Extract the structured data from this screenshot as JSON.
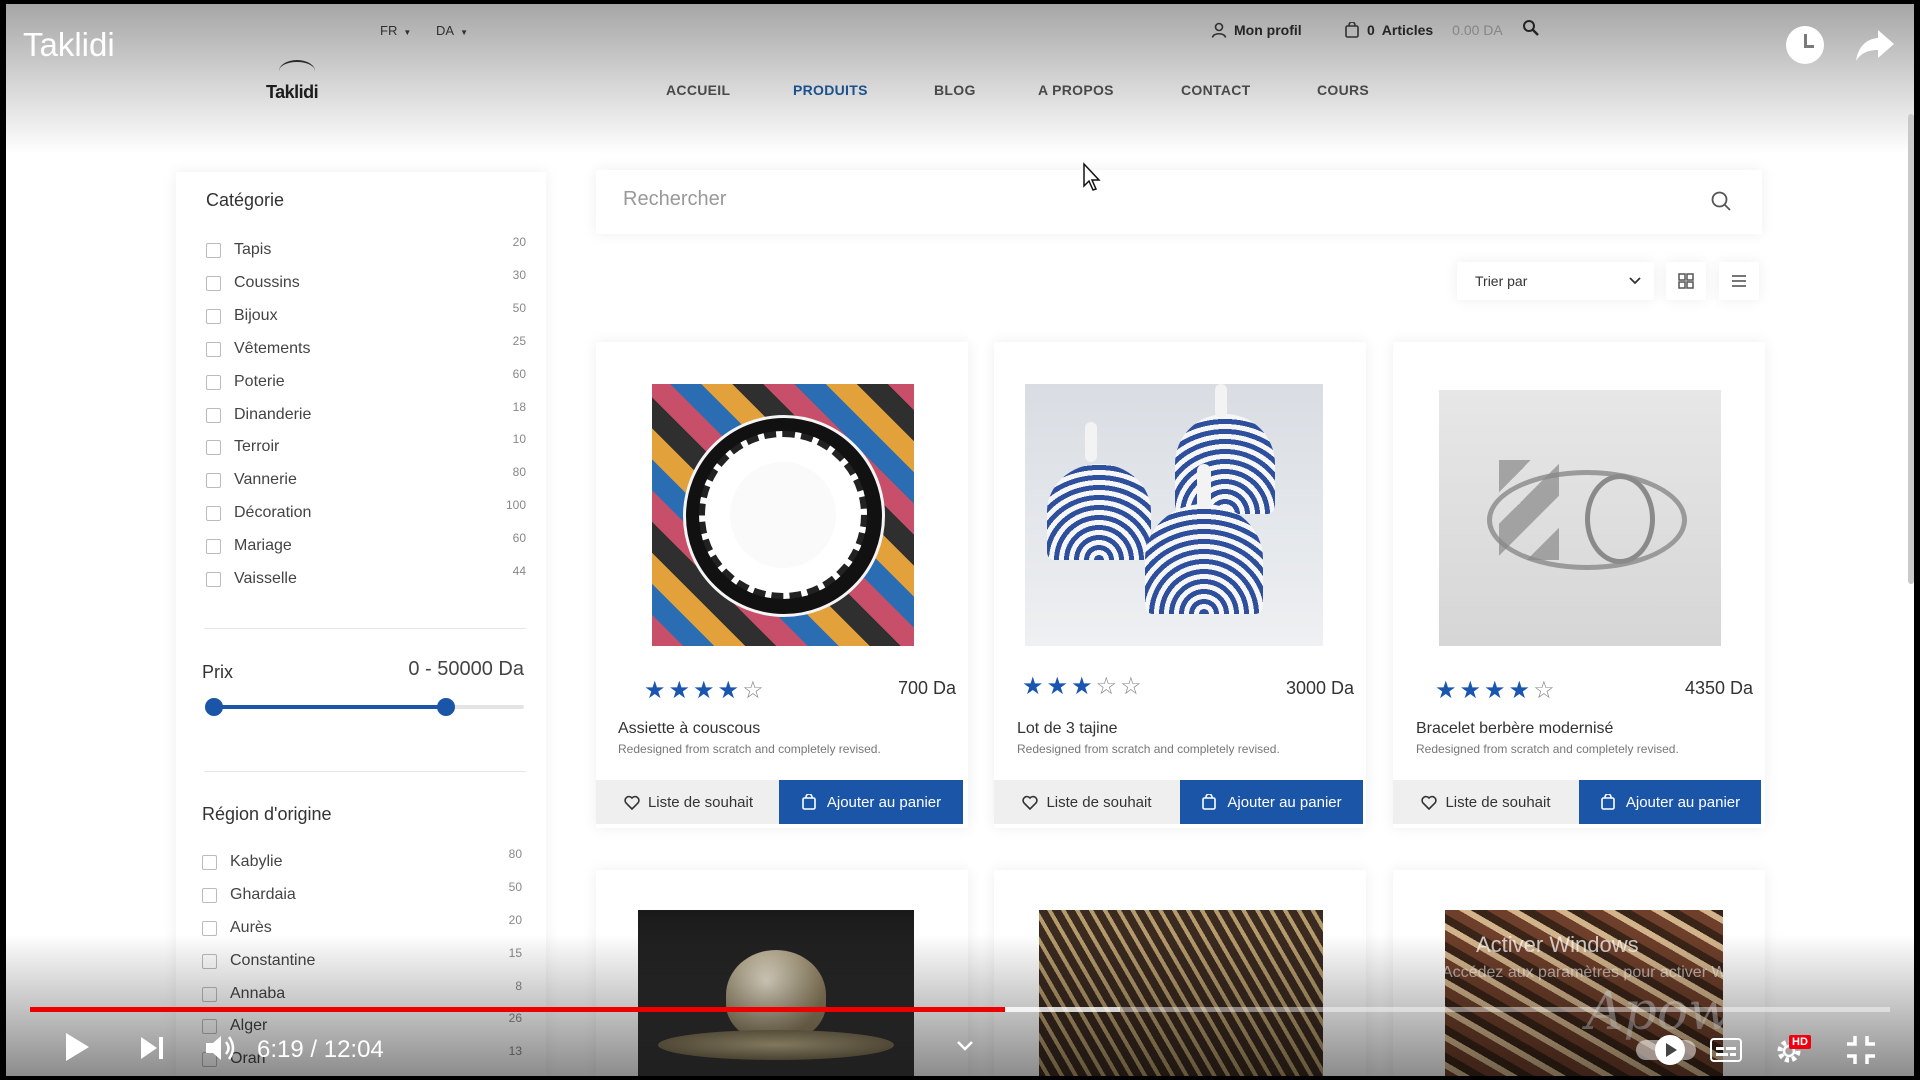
{
  "video": {
    "title": "Taklidi",
    "time": "6:19 / 12:04",
    "progress": 0.524,
    "hd": "HD"
  },
  "header": {
    "logo": "Taklidi",
    "lang": "FR",
    "currency": "DA",
    "profile": "Mon profil",
    "cart_count": "0",
    "cart_label": "Articles",
    "cart_total": "0.00 DA"
  },
  "nav": [
    {
      "label": "ACCUEIL"
    },
    {
      "label": "PRODUITS",
      "active": true
    },
    {
      "label": "BLOG"
    },
    {
      "label": "A PROPOS"
    },
    {
      "label": "CONTACT"
    },
    {
      "label": "COURS"
    }
  ],
  "sidebar": {
    "category_title": "Catégorie",
    "categories": [
      {
        "label": "Tapis",
        "count": "20"
      },
      {
        "label": "Coussins",
        "count": "30"
      },
      {
        "label": "Bijoux",
        "count": "50"
      },
      {
        "label": "Vêtements",
        "count": "25"
      },
      {
        "label": "Poterie",
        "count": "60"
      },
      {
        "label": "Dinanderie",
        "count": "18"
      },
      {
        "label": "Terroir",
        "count": "10"
      },
      {
        "label": "Vannerie",
        "count": "80"
      },
      {
        "label": "Décoration",
        "count": "100"
      },
      {
        "label": "Mariage",
        "count": "60"
      },
      {
        "label": "Vaisselle",
        "count": "44"
      }
    ],
    "price_title": "Prix",
    "price_range": "0 - 50000 Da",
    "price_slider_min_frac": 0.0,
    "price_slider_max_frac": 0.75,
    "region_title": "Région d'origine",
    "regions": [
      {
        "label": "Kabylie",
        "count": "80"
      },
      {
        "label": "Ghardaia",
        "count": "50"
      },
      {
        "label": "Aurès",
        "count": "20"
      },
      {
        "label": "Constantine",
        "count": "15"
      },
      {
        "label": "Annaba",
        "count": "8"
      },
      {
        "label": "Alger",
        "count": "26"
      },
      {
        "label": "Oran",
        "count": "13"
      }
    ]
  },
  "search": {
    "placeholder": "Rechercher"
  },
  "sort": {
    "label": "Trier par"
  },
  "products": [
    {
      "name": "Assiette à couscous",
      "desc": "Redesigned from scratch and completely revised.",
      "price": "700 Da",
      "rating": 4
    },
    {
      "name": "Lot de 3 tajine",
      "desc": "Redesigned from scratch and completely revised.",
      "price": "3000 Da",
      "rating": 3
    },
    {
      "name": "Bracelet berbère modernisé",
      "desc": "Redesigned from scratch and completely revised.",
      "price": "4350 Da",
      "rating": 4
    }
  ],
  "card_buttons": {
    "wishlist": "Liste de souhait",
    "add_to_cart": "Ajouter au panier"
  },
  "watermark": {
    "activate_title": "Activer Windows",
    "activate_sub": "Accédez aux paramètres pour activer Windows.",
    "brand": "Apowersoft"
  },
  "colors": {
    "accent": "#1b55a8",
    "nav_active": "#1f5fa6",
    "progress": "#ee0000"
  }
}
